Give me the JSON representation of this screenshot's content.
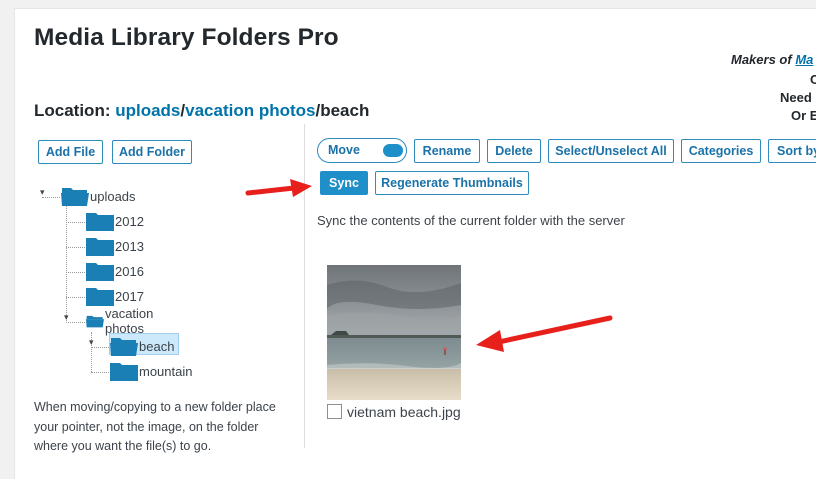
{
  "page": {
    "title": "Media Library Folders Pro",
    "makers_prefix": "Makers of ",
    "makers_link": "Ma",
    "side_lines": [
      "C",
      "Need",
      "Or E"
    ]
  },
  "location": {
    "label": "Location: ",
    "crumbs": [
      "uploads",
      "vacation photos"
    ],
    "separator": "/",
    "current": "beach"
  },
  "left_toolbar": {
    "add_file": "Add File",
    "add_folder": "Add Folder"
  },
  "toolbar": {
    "move": "Move",
    "rename": "Rename",
    "delete": "Delete",
    "select_all": "Select/Unselect All",
    "categories": "Categories",
    "sort_by": "Sort by",
    "sync": "Sync",
    "regen": "Regenerate Thumbnails"
  },
  "sync_description": "Sync the contents of the current folder with the server",
  "folder_tree": [
    {
      "label": "uploads",
      "depth": 0,
      "open": true
    },
    {
      "label": "2012",
      "depth": 1
    },
    {
      "label": "2013",
      "depth": 1
    },
    {
      "label": "2016",
      "depth": 1
    },
    {
      "label": "2017",
      "depth": 1
    },
    {
      "label": "vacation photos",
      "depth": 1,
      "open": true
    },
    {
      "label": "beach",
      "depth": 2,
      "open": true,
      "selected": true
    },
    {
      "label": "mountain",
      "depth": 2
    }
  ],
  "help_text": "When moving/copying to a new folder place your pointer, not the image, on the folder where you want the file(s) to go.",
  "file": {
    "name": "vietnam beach.jpg",
    "checked": false
  },
  "colors": {
    "accent": "#1f8fca",
    "link": "#0073aa",
    "folder": "#1a7fb5",
    "arrow": "#e8201c"
  },
  "icons": {
    "folder": "folder-icon",
    "folder_open": "folder-open-icon"
  }
}
